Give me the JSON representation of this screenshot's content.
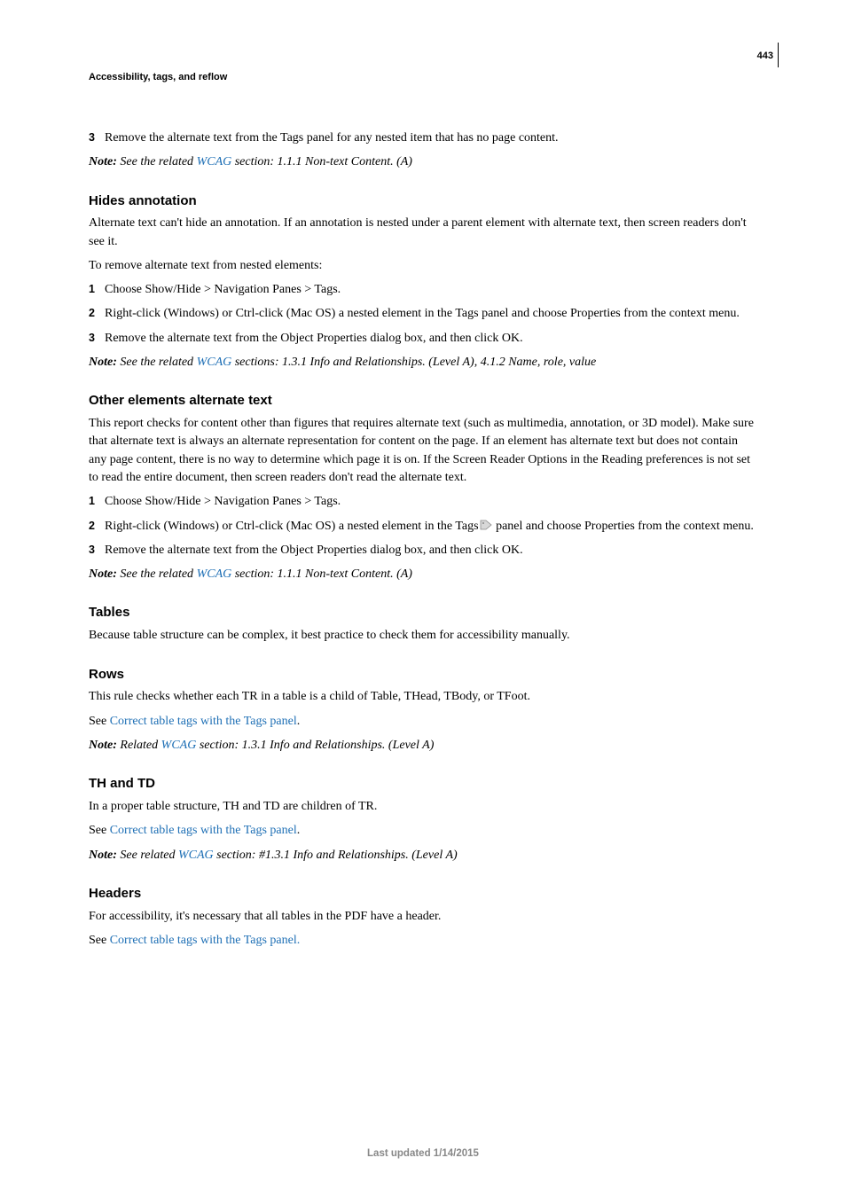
{
  "page_number": "443",
  "top_label": "Accessibility, tags, and reflow",
  "intro_item": {
    "num": "3",
    "text": "Remove the alternate text from the Tags panel for any nested item that has no page content."
  },
  "intro_note": {
    "prefix": "Note:",
    "before": " See the related ",
    "link": "WCAG",
    "after": " section: 1.1.1 Non-text Content. (A)"
  },
  "hides": {
    "heading": "Hides annotation",
    "p1": "Alternate text can't hide an annotation. If an annotation is nested under a parent element with alternate text, then screen readers don't see it.",
    "p2": "To remove alternate text from nested elements:",
    "items": [
      {
        "num": "1",
        "text": "Choose Show/Hide > Navigation Panes > Tags."
      },
      {
        "num": "2",
        "text": "Right-click (Windows) or Ctrl-click (Mac OS) a nested element in the Tags panel and choose Properties from the context menu."
      },
      {
        "num": "3",
        "text": "Remove the alternate text from the Object Properties dialog box, and then click OK."
      }
    ],
    "note": {
      "prefix": "Note:",
      "before": " See the related ",
      "link": "WCAG",
      "after": " sections: 1.3.1 Info and Relationships. (Level A), 4.1.2 Name, role, value"
    }
  },
  "other": {
    "heading": "Other elements alternate text",
    "p1": "This report checks for content other than figures that requires alternate text (such as multimedia, annotation, or 3D model). Make sure that alternate text is always an alternate representation for content on the page. If an element has alternate text but does not contain any page content, there is no way to determine which page it is on. If the Screen Reader Options in the Reading preferences is not set to read the entire document, then screen readers don't read the alternate text.",
    "items": [
      {
        "num": "1",
        "text": "Choose Show/Hide > Navigation Panes > Tags."
      },
      {
        "num": "2",
        "before": "Right-click (Windows) or Ctrl-click (Mac OS) a nested element in the Tags",
        "after": " panel and choose Properties from the context menu."
      },
      {
        "num": "3",
        "text": "Remove the alternate text from the Object Properties dialog box, and then click OK."
      }
    ],
    "note": {
      "prefix": "Note:",
      "before": " See the related ",
      "link": "WCAG",
      "after": " section: 1.1.1 Non-text Content. (A)"
    }
  },
  "tables": {
    "heading": "Tables",
    "p1": "Because table structure can be complex, it best practice to check them for accessibility manually."
  },
  "rows": {
    "heading": "Rows",
    "p1": "This rule checks whether each TR in a table is a child of Table, THead, TBody, or TFoot.",
    "see": {
      "before": "See ",
      "link": "Correct table tags with the Tags panel",
      "after": "."
    },
    "note": {
      "prefix": "Note:",
      "before": " Related ",
      "link": "WCAG",
      "after": " section: 1.3.1 Info and Relationships. (Level A)"
    }
  },
  "thtd": {
    "heading": "TH and TD",
    "p1": "In a proper table structure, TH and TD are children of TR.",
    "see": {
      "before": "See ",
      "link": "Correct table tags with the Tags panel",
      "after": "."
    },
    "note": {
      "prefix": "Note:",
      "before": " See related ",
      "link": "WCAG",
      "after": " section: #1.3.1 Info and Relationships. (Level A)"
    }
  },
  "headers": {
    "heading": "Headers",
    "p1": "For accessibility, it's necessary that all tables in the PDF have a header.",
    "see": {
      "before": "See ",
      "link": "Correct table tags with the Tags panel."
    }
  },
  "footer": "Last updated 1/14/2015"
}
